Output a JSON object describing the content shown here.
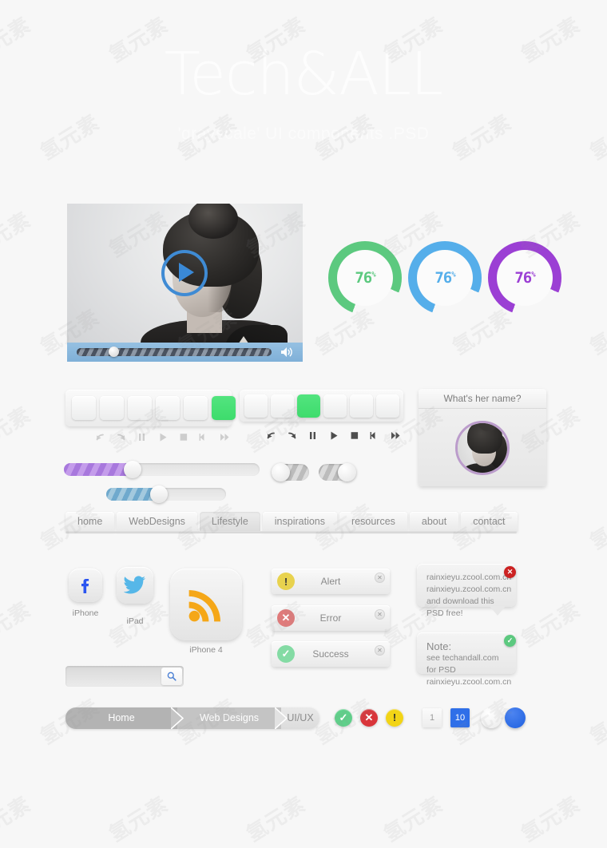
{
  "header": {
    "title": "Tech&ALL",
    "subtitle": "'grayscale' UI components .PSD"
  },
  "video_player": {
    "name": "video-player",
    "play_icon": "play-icon",
    "volume_icon": "volume-icon",
    "progress_percent": 20,
    "bar_color": "#8bb8dd",
    "accent_color": "#3a89d6"
  },
  "progress_rings": [
    {
      "value": "76",
      "unit": "%",
      "percent": 76,
      "color": "#5cc97f"
    },
    {
      "value": "76",
      "unit": "%",
      "percent": 76,
      "color": "#55aeea"
    },
    {
      "value": "76",
      "unit": "%",
      "percent": 76,
      "color": "#9b3fd4"
    }
  ],
  "toolbar_light": {
    "name": "light-button-strip",
    "buttons": [
      "",
      "",
      "",
      "",
      "",
      ""
    ],
    "highlight_index": 5,
    "highlight_color": "#ea3a34",
    "controls": [
      {
        "name": "undo-icon",
        "glyph": "undo"
      },
      {
        "name": "redo-icon",
        "glyph": "redo"
      },
      {
        "name": "pause-icon",
        "glyph": "pause"
      },
      {
        "name": "play-icon",
        "glyph": "play"
      },
      {
        "name": "stop-icon",
        "glyph": "stop"
      },
      {
        "name": "rewind-icon",
        "glyph": "rewind"
      },
      {
        "name": "fast-forward-icon",
        "glyph": "forward"
      }
    ]
  },
  "toolbar_dark": {
    "name": "dark-button-strip",
    "buttons": [
      "",
      "",
      "",
      "",
      "",
      ""
    ],
    "highlight_index": 2,
    "highlight_color": "#45de77",
    "controls": [
      {
        "name": "undo-icon",
        "glyph": "undo"
      },
      {
        "name": "redo-icon",
        "glyph": "redo"
      },
      {
        "name": "pause-icon",
        "glyph": "pause"
      },
      {
        "name": "play-icon",
        "glyph": "play"
      },
      {
        "name": "stop-icon",
        "glyph": "stop"
      },
      {
        "name": "rewind-icon",
        "glyph": "rewind"
      },
      {
        "name": "fast-forward-icon",
        "glyph": "forward"
      }
    ]
  },
  "sliders": [
    {
      "name": "slider-purple",
      "percent": 35,
      "color": "#b88ae4"
    },
    {
      "name": "slider-blue",
      "percent": 44,
      "color": "#7fb3d4"
    }
  ],
  "toggles": [
    {
      "name": "toggle-off",
      "state": "off"
    },
    {
      "name": "toggle-on",
      "state": "on"
    }
  ],
  "avatar_card": {
    "title": "What's her name?",
    "ring_color": "#bb9ccb"
  },
  "nav_tabs": [
    {
      "label": "home",
      "active": false
    },
    {
      "label": "WebDesigns",
      "active": false
    },
    {
      "label": "Lifestyle",
      "active": true
    },
    {
      "label": "inspirations",
      "active": false
    },
    {
      "label": "resources",
      "active": false
    },
    {
      "label": "about",
      "active": false
    },
    {
      "label": "contact",
      "active": false
    }
  ],
  "app_icons": [
    {
      "icon": "facebook-icon",
      "label": "iPhone",
      "color": "#2b55f0"
    },
    {
      "icon": "twitter-icon",
      "label": "iPad",
      "color": "#56b7e8"
    },
    {
      "icon": "rss-icon",
      "label": "iPhone 4",
      "color": "#f5a718"
    }
  ],
  "alerts": [
    {
      "label": "Alert",
      "icon": "warning-icon",
      "glyph": "!",
      "color": "#e8d24e",
      "close": "close-icon",
      "close_glyph": "✕"
    },
    {
      "label": "Error",
      "icon": "error-icon",
      "glyph": "✕",
      "color": "#e07a7a",
      "close": "close-icon",
      "close_glyph": "✕"
    },
    {
      "label": "Success",
      "icon": "success-icon",
      "glyph": "✓",
      "color": "#84dba4",
      "close": "close-icon",
      "close_glyph": "✕"
    }
  ],
  "tooltips": [
    {
      "lines": [
        "rainxieyu.zcool.com.cn",
        "rainxieyu.zcool.com.cn",
        "and download this PSD free!"
      ],
      "badge": {
        "name": "error-badge",
        "glyph": "✕",
        "color": "#cc2222"
      }
    },
    {
      "lines": [
        "Note:",
        "see techandall.com for PSD",
        "rainxieyu.zcool.com.cn"
      ],
      "badge": {
        "name": "success-badge",
        "glyph": "✓",
        "color": "#5cc97f"
      }
    }
  ],
  "search": {
    "value": "",
    "placeholder": "",
    "icon": "search-icon",
    "icon_color": "#4a7fd4"
  },
  "breadcrumb": [
    {
      "label": "Home",
      "active": true
    },
    {
      "label": "Web Designs",
      "active": true
    },
    {
      "label": "UI/UX",
      "active": false
    }
  ],
  "status_badges": [
    {
      "name": "success-badge",
      "glyph": "✓",
      "color": "#5fd08a"
    },
    {
      "name": "error-badge",
      "glyph": "✕",
      "color": "#d9353a"
    },
    {
      "name": "warning-badge",
      "glyph": "!",
      "color": "#f2d416"
    }
  ],
  "pagination": [
    {
      "label": "1",
      "active": false
    },
    {
      "label": "10",
      "active": true
    }
  ],
  "radios": [
    {
      "name": "radio-unselected",
      "selected": false
    },
    {
      "name": "radio-selected",
      "selected": true
    }
  ],
  "watermark": {
    "text": "氢元素"
  }
}
